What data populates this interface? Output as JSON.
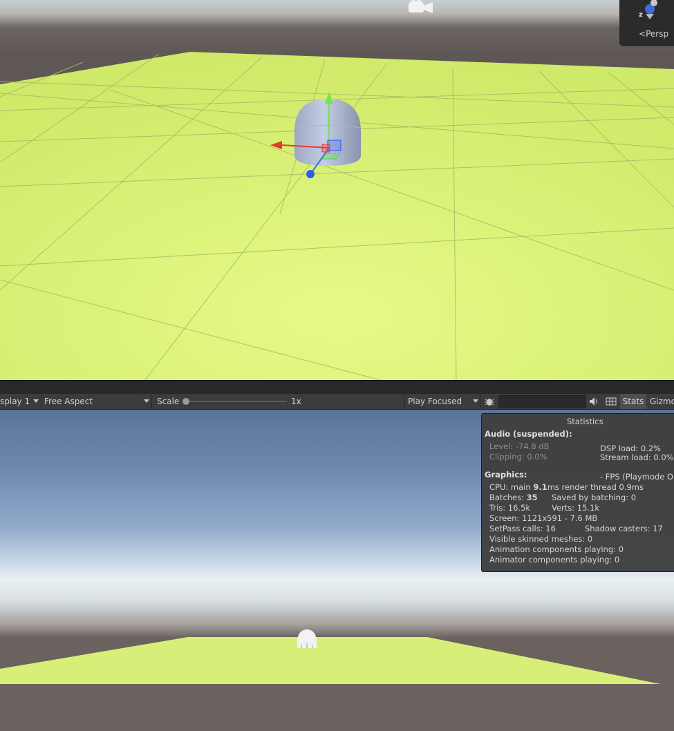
{
  "scene": {
    "persp_label": "Persp",
    "axis_label": "z",
    "colors": {
      "ground": "#dff57e",
      "grid": "#9fb05a",
      "horizon": "#5f5755"
    }
  },
  "toolbar": {
    "display": "splay 1",
    "aspect": "Free Aspect",
    "scale_label": "Scale",
    "scale_value": "1x",
    "play_mode": "Play Focused",
    "stats": "Stats",
    "gizmos": "Gizmo"
  },
  "stats": {
    "title": "Statistics",
    "audio_header": "Audio (suspended):",
    "level": "Level: -74.8 dB",
    "clipping": "Clipping: 0.0%",
    "dsp_load": "DSP load: 0.2%",
    "stream_load": "Stream load: 0.0%",
    "graphics_header": "Graphics:",
    "fps": "- FPS (Playmode O",
    "cpu_prefix": "CPU: main ",
    "cpu_main": "9.1",
    "cpu_suffix": "ms  render thread 0.9ms",
    "batches_prefix": "Batches: ",
    "batches": "35",
    "saved_batching": "Saved by batching: 0",
    "tris": "Tris: 16.5k",
    "verts": "Verts: 15.1k",
    "screen": "Screen: 1121x591 - 7.6 MB",
    "setpass": "SetPass calls: 16",
    "shadow_casters": "Shadow casters: 17",
    "skinned_meshes": "Visible skinned meshes: 0",
    "animation_components": "Animation components playing: 0",
    "animator_components": "Animator components playing: 0"
  }
}
